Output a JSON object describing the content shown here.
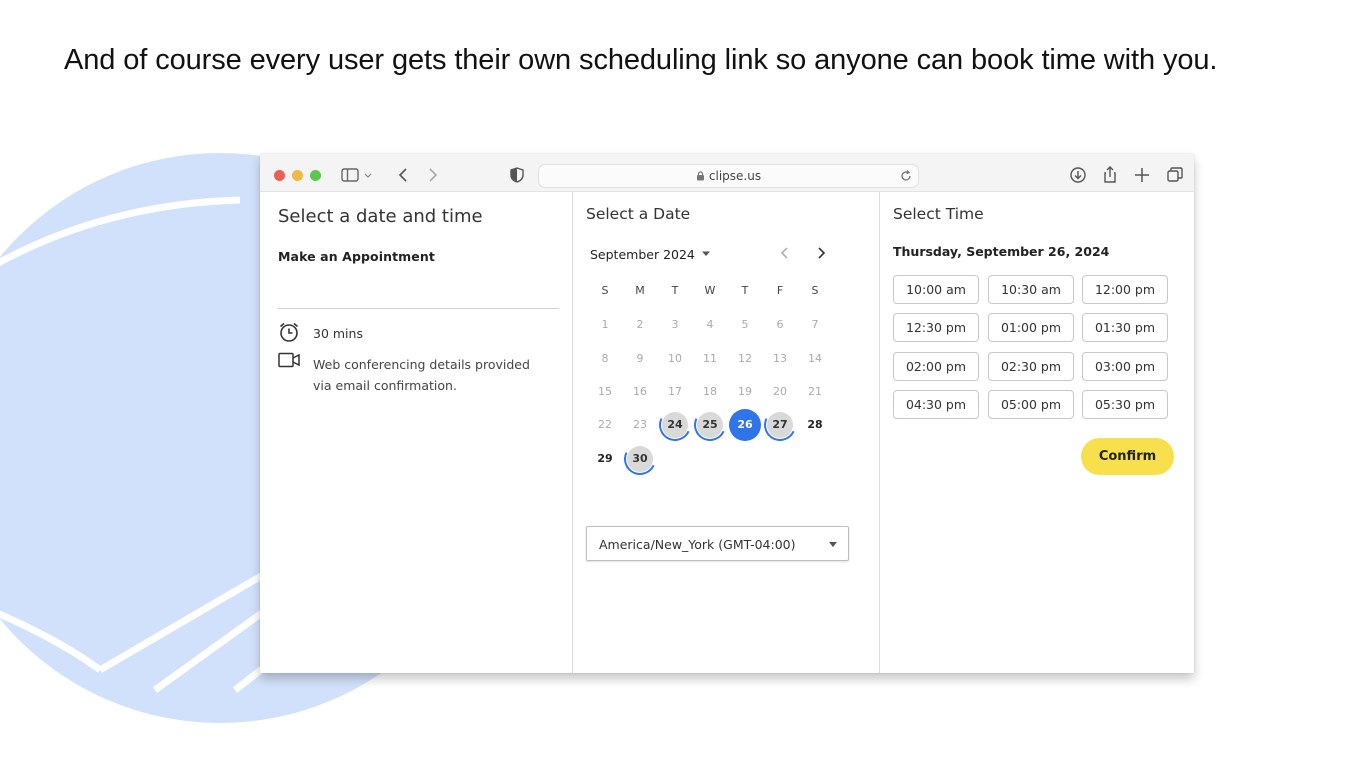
{
  "slide": {
    "caption": "And of course every user gets their own scheduling link so anyone can book time with you."
  },
  "browser": {
    "url": "clipse.us"
  },
  "booking": {
    "title": "Select a date and time",
    "subtitle": "Make an Appointment",
    "duration": "30 mins",
    "conferencing": "Web conferencing details provided via email confirmation."
  },
  "calendar": {
    "title": "Select a Date",
    "month": "September 2024",
    "weekdays": [
      "S",
      "M",
      "T",
      "W",
      "T",
      "F",
      "S"
    ],
    "weeks": [
      [
        {
          "d": "1",
          "s": "off"
        },
        {
          "d": "2",
          "s": "off"
        },
        {
          "d": "3",
          "s": "off"
        },
        {
          "d": "4",
          "s": "off"
        },
        {
          "d": "5",
          "s": "off"
        },
        {
          "d": "6",
          "s": "off"
        },
        {
          "d": "7",
          "s": "off"
        }
      ],
      [
        {
          "d": "8",
          "s": "off"
        },
        {
          "d": "9",
          "s": "off"
        },
        {
          "d": "10",
          "s": "off"
        },
        {
          "d": "11",
          "s": "off"
        },
        {
          "d": "12",
          "s": "off"
        },
        {
          "d": "13",
          "s": "off"
        },
        {
          "d": "14",
          "s": "off"
        }
      ],
      [
        {
          "d": "15",
          "s": "off"
        },
        {
          "d": "16",
          "s": "off"
        },
        {
          "d": "17",
          "s": "off"
        },
        {
          "d": "18",
          "s": "off"
        },
        {
          "d": "19",
          "s": "off"
        },
        {
          "d": "20",
          "s": "off"
        },
        {
          "d": "21",
          "s": "off"
        }
      ],
      [
        {
          "d": "22",
          "s": "off"
        },
        {
          "d": "23",
          "s": "off"
        },
        {
          "d": "24",
          "s": "avail"
        },
        {
          "d": "25",
          "s": "avail"
        },
        {
          "d": "26",
          "s": "selected"
        },
        {
          "d": "27",
          "s": "avail"
        },
        {
          "d": "28",
          "s": "bold"
        }
      ],
      [
        {
          "d": "29",
          "s": "bold"
        },
        {
          "d": "30",
          "s": "avail"
        }
      ]
    ],
    "timezone": "America/New_York (GMT-04:00)"
  },
  "times": {
    "title": "Select Time",
    "date": "Thursday, September 26, 2024",
    "slots": [
      "10:00 am",
      "10:30 am",
      "12:00 pm",
      "12:30 pm",
      "01:00 pm",
      "01:30 pm",
      "02:00 pm",
      "02:30 pm",
      "03:00 pm",
      "04:30 pm",
      "05:00 pm",
      "05:30 pm"
    ],
    "confirm_label": "Confirm"
  },
  "colors": {
    "accent": "#2f74e8",
    "confirm": "#f7e04c",
    "decor": "#d2e1fb"
  }
}
